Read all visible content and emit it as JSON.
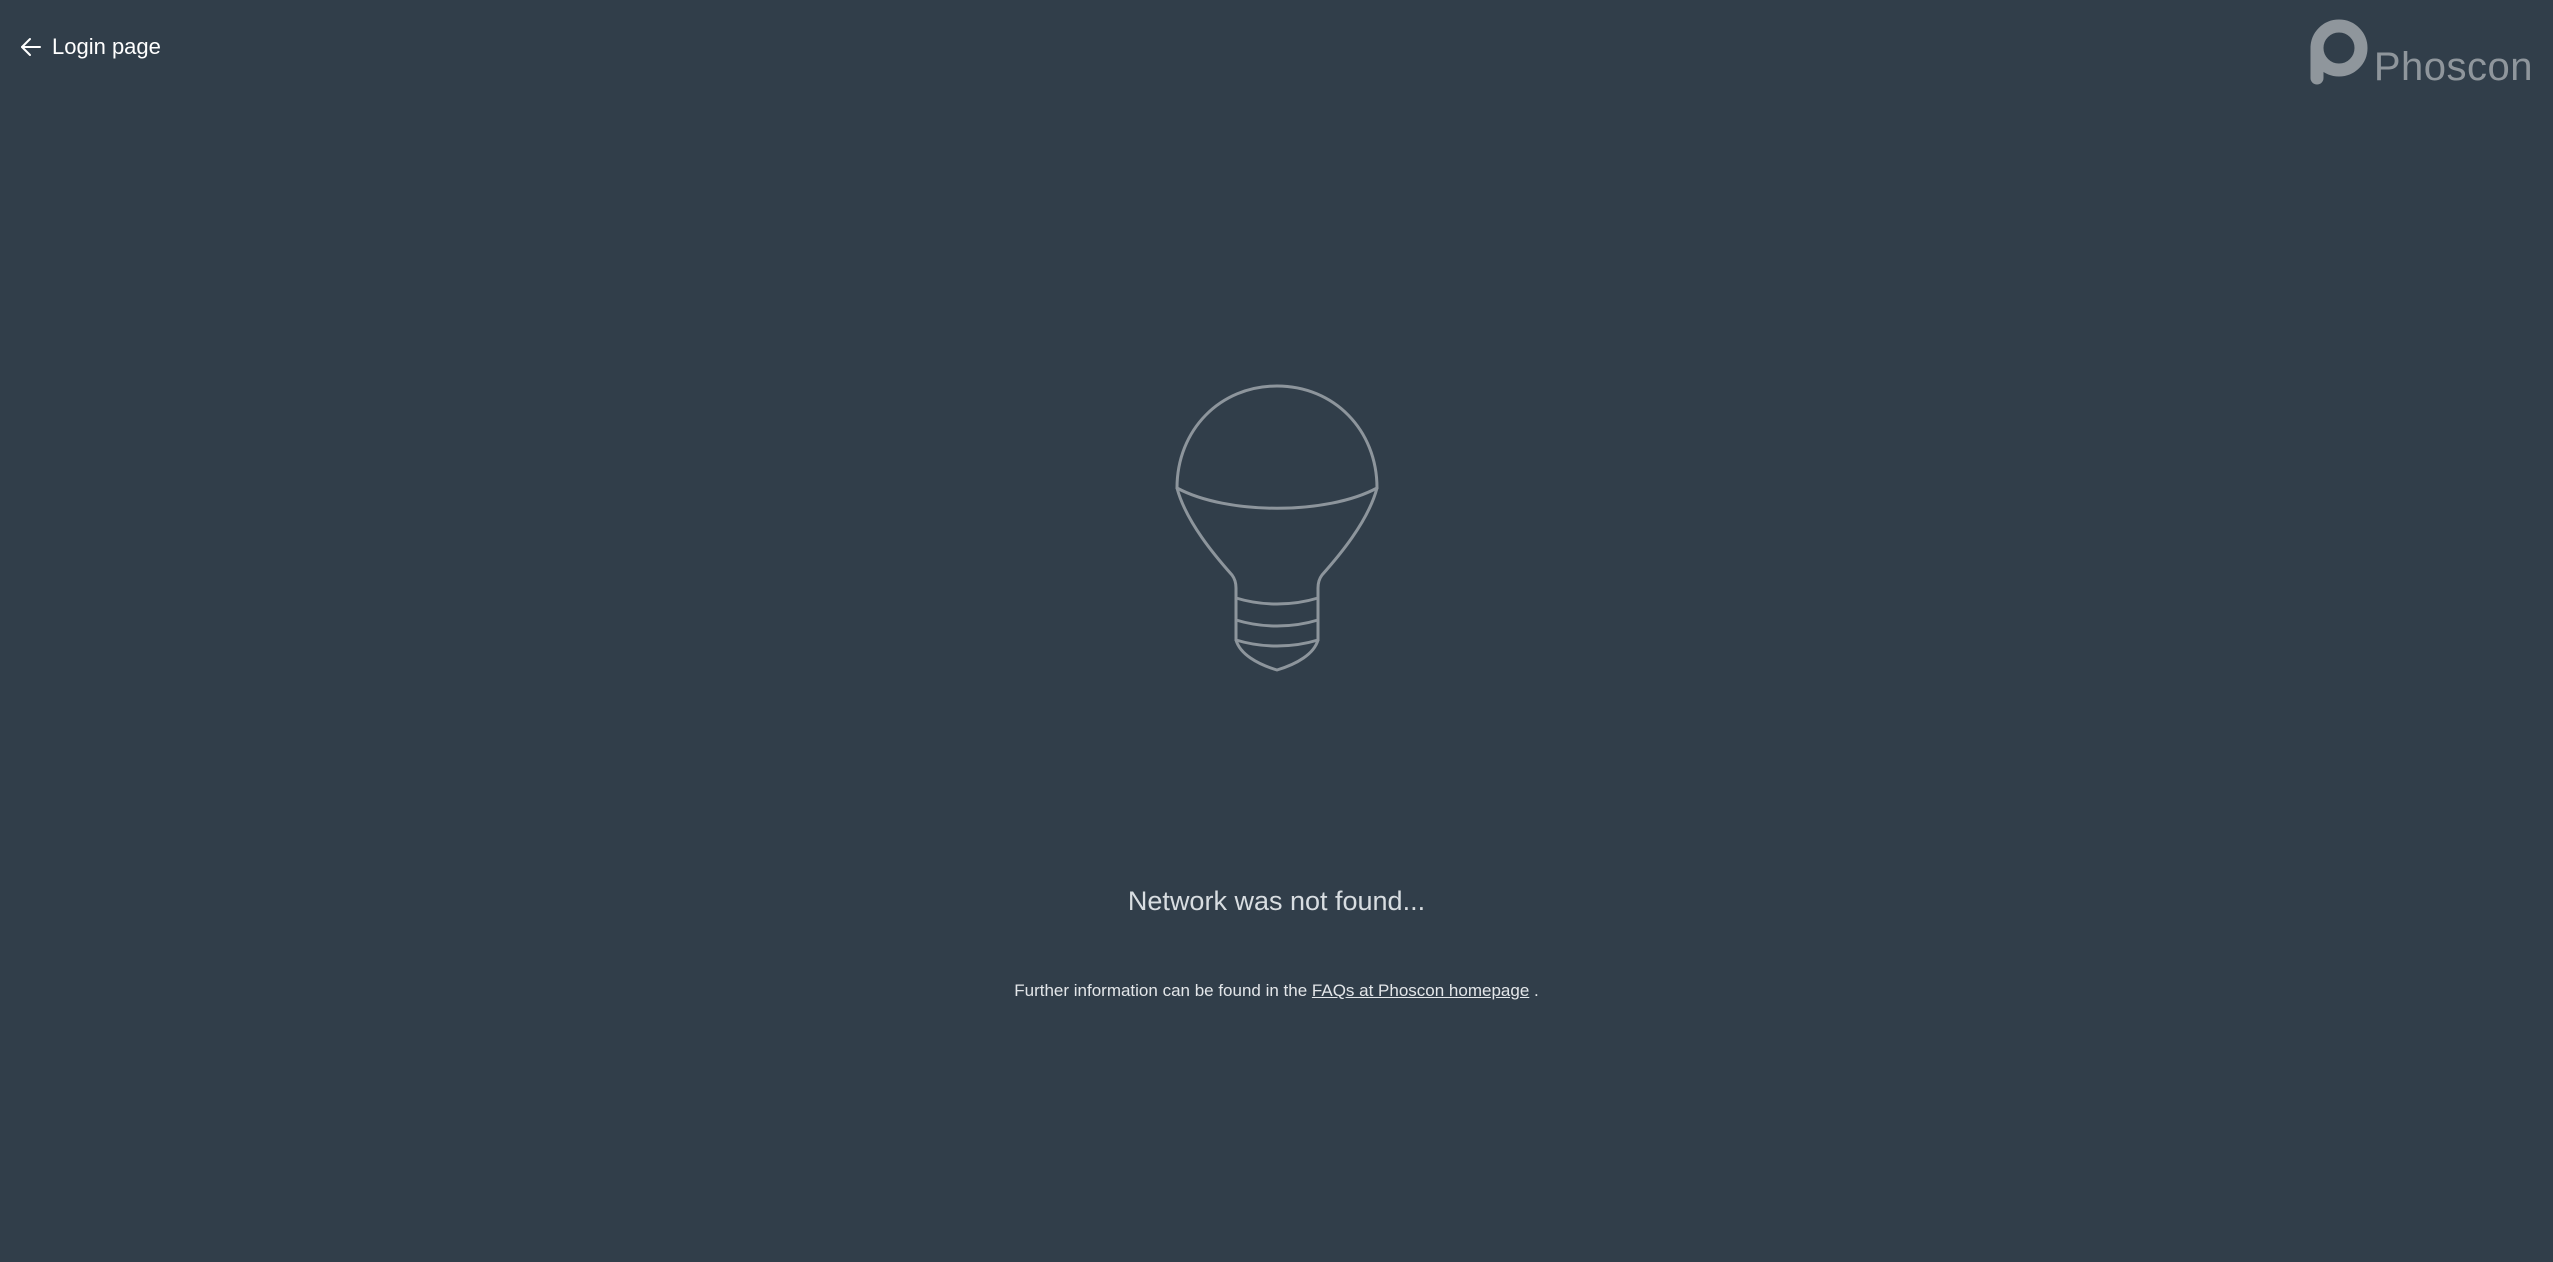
{
  "nav": {
    "back_label": "Login page",
    "back_icon": "arrow-left-icon"
  },
  "brand": {
    "name": "Phoscon",
    "logo_icon": "phoscon-logo-icon",
    "color": "#8f969c"
  },
  "illustration": {
    "icon": "lightbulb-icon",
    "stroke_color": "#8d959c"
  },
  "status": {
    "message": "Network was not found..."
  },
  "info": {
    "prefix": "Further information can be found in the",
    "link_label": "FAQs at Phoscon homepage",
    "suffix": "."
  },
  "colors": {
    "background": "#313e4a",
    "text": "#ffffff"
  }
}
